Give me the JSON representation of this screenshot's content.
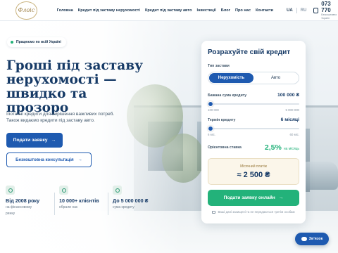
{
  "header": {
    "logo_text": "Флоіс",
    "nav": [
      "Головна",
      "Кредит під заставу нерухомості",
      "Кредит під заставу авто",
      "Інвестиції",
      "Блог",
      "Про нас",
      "Контакти"
    ],
    "lang_active": "UA",
    "lang_other": "RU",
    "phone": "073 770",
    "phone_note_1": "Безкоштовно",
    "phone_note_2": "Україні"
  },
  "hero": {
    "badge": "Працюємо по всій Україні",
    "title_1": "Гроші під заставу",
    "title_2": "нерухомості —",
    "title_3": "швидко та прозоро",
    "desc_1": "Іпотечні кредити для вирішення важливих потреб.",
    "desc_2": "Також видаємо кредити під заставу авто.",
    "primary_btn": "Подати заявку",
    "outline_btn": "Безкоштовна консультація",
    "arrow": "→"
  },
  "stats": [
    {
      "value": "Від 2008 року",
      "label_1": "на фінансовому",
      "label_2": "ринку"
    },
    {
      "value": "10 000+ клієнтів",
      "label_1": "обрали нас",
      "label_2": ""
    },
    {
      "value": "До 5 000 000 ₴",
      "label_1": "сума кредиту",
      "label_2": ""
    }
  ],
  "calculator": {
    "title": "Розрахуйте свій кредит",
    "collateral_label": "Тип застави",
    "collateral_options": [
      "Нерухомість",
      "Авто"
    ],
    "amount_label": "Бажана сума кредиту",
    "amount_value": "100 000 ₴",
    "amount_min": "100 000",
    "amount_max": "5 000 000",
    "amount_fraction": 0.0,
    "term_label": "Термін кредиту",
    "term_value": "6 місяці",
    "term_min": "6 міс.",
    "term_max": "60 міс.",
    "term_fraction": 0.0,
    "rate_label": "Орієнтовна ставка",
    "rate_value": "2,5%",
    "rate_unit": "на місяць",
    "payment_label": "Місячний платіж",
    "payment_value": "≈ 2 500 ₴",
    "cta": "Подати заявку онлайн",
    "privacy": "Ваші дані захищені та не передаються третім особам"
  },
  "chat": {
    "label": "Зв'язок"
  },
  "colors": {
    "primary": "#1e5ab0",
    "accent_green": "#23b27a",
    "heading": "#163a66",
    "gold": "#9a7b3e"
  }
}
